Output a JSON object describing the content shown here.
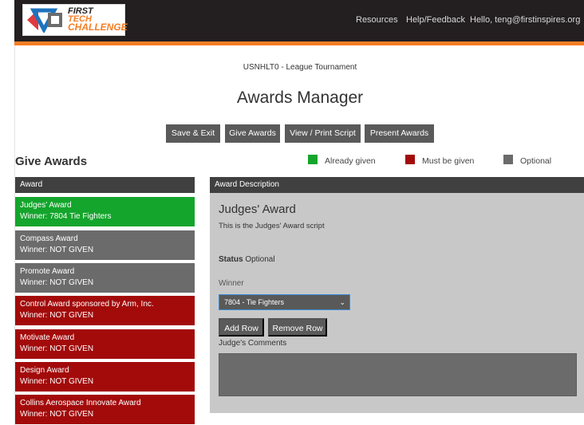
{
  "header": {
    "logo": {
      "line1": "FIRST",
      "line2": "TECH",
      "line3": "CHALLENGE"
    },
    "nav": {
      "resources": "Resources",
      "help": "Help/Feedback",
      "user": "Hello, teng@firstinspires.org"
    }
  },
  "event_name": "USNHLT0 - League Tournament",
  "page_title": "Awards Manager",
  "toolbar": {
    "save_exit": "Save & Exit",
    "give_awards": "Give Awards",
    "print_script": "View / Print Script",
    "present_awards": "Present Awards"
  },
  "section_title": "Give Awards",
  "legend": [
    {
      "label": "Already given",
      "color": "#14a52c"
    },
    {
      "label": "Must be given",
      "color": "#a30b0b"
    },
    {
      "label": "Optional",
      "color": "#6b6b6b"
    }
  ],
  "awards_header": "Award",
  "awards": [
    {
      "name": "Judges' Award",
      "winner": "Winner: 7804 Tie Fighters",
      "state": "given",
      "color": "#14a52c"
    },
    {
      "name": "Compass Award",
      "winner": "Winner: NOT GIVEN",
      "state": "optional",
      "color": "#6b6b6b"
    },
    {
      "name": "Promote Award",
      "winner": "Winner: NOT GIVEN",
      "state": "optional",
      "color": "#6b6b6b"
    },
    {
      "name": "Control Award sponsored by Arm, Inc.",
      "winner": "Winner: NOT GIVEN",
      "state": "required",
      "color": "#a30b0b"
    },
    {
      "name": "Motivate Award",
      "winner": "Winner: NOT GIVEN",
      "state": "required",
      "color": "#a30b0b"
    },
    {
      "name": "Design Award",
      "winner": "Winner: NOT GIVEN",
      "state": "required",
      "color": "#a30b0b"
    },
    {
      "name": "Collins Aerospace Innovate Award",
      "winner": "Winner: NOT GIVEN",
      "state": "required",
      "color": "#a30b0b"
    }
  ],
  "detail": {
    "header": "Award Description",
    "title": "Judges' Award",
    "script": "This is the Judges' Award script",
    "status_label": "Status",
    "status_value": "Optional",
    "winner_label": "Winner",
    "winner_value": "7804 - Tie Fighters",
    "add_row": "Add Row",
    "remove_row": "Remove Row",
    "comments_label": "Judge's Comments",
    "comments_value": ""
  }
}
